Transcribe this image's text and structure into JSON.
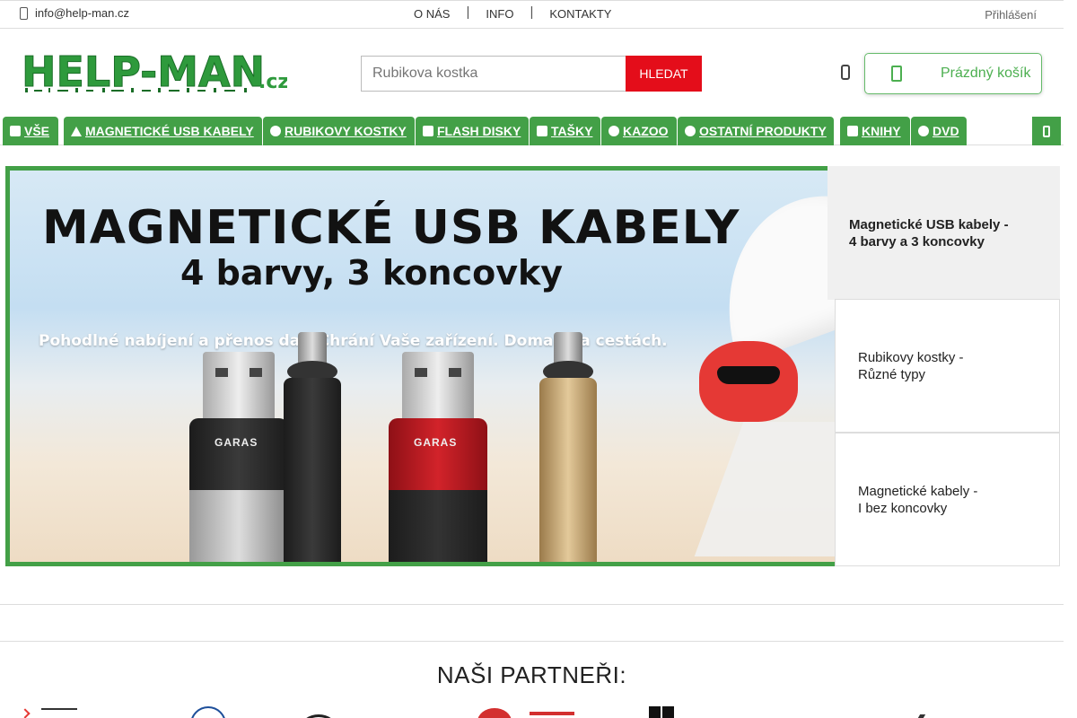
{
  "topbar": {
    "email": "info@help-man.cz",
    "nav": [
      "O NÁS",
      "INFO",
      "KONTAKTY"
    ],
    "login": "Přihlášení"
  },
  "header": {
    "logo_text": "HELP-MAN",
    "logo_tld": ".cz",
    "search": {
      "placeholder": "Rubikova kostka",
      "button_label": "HLEDAT"
    },
    "cart_label": "Prázdný košík"
  },
  "categories": [
    {
      "label": "VŠE",
      "icon": "share-icon"
    },
    {
      "label": "MAGNETICKÉ USB KABELY",
      "icon": "usb-icon"
    },
    {
      "label": "RUBIKOVY KOSTKY",
      "icon": "brain-icon"
    },
    {
      "label": "FLASH DISKY",
      "icon": "flash-drive-icon"
    },
    {
      "label": "TAŠKY",
      "icon": "bag-icon"
    },
    {
      "label": "KAZOO",
      "icon": "music-icon"
    },
    {
      "label": "OSTATNÍ PRODUKTY",
      "icon": "bicycle-icon"
    },
    {
      "label": "KNIHY",
      "icon": "book-icon"
    },
    {
      "label": "DVD",
      "icon": "disc-icon"
    }
  ],
  "banner": {
    "title": "MAGNETICKÉ USB KABELY",
    "subtitle": "4 barvy, 3 koncovky",
    "tagline": "Pohodlné nabíjení a přenos dat. Chrání Vaše zařízení. Doma i na cestách.",
    "brand": "GARAS"
  },
  "slides": [
    {
      "line1": "Magnetické USB kabely -",
      "line2": "4 barvy a 3 koncovky",
      "active": true
    },
    {
      "line1": "Rubikovy kostky -",
      "line2": "Různé typy",
      "active": false
    },
    {
      "line1": "Magnetické kabely -",
      "line2": "I bez koncovky",
      "active": false
    }
  ],
  "partners_title": "NAŠI PARTNEŘI:",
  "colors": {
    "brand_green": "#43a047",
    "search_red": "#e40d1a",
    "cart_green": "#4caf50"
  }
}
